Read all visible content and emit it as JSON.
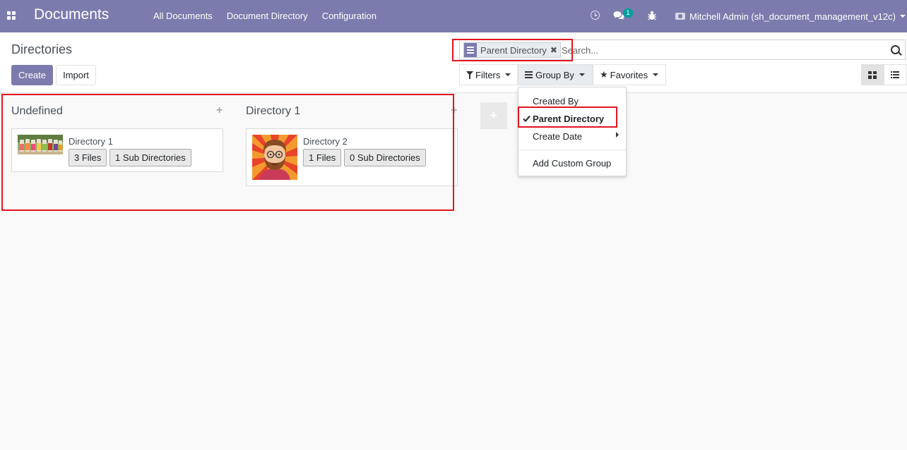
{
  "navbar": {
    "brand": "Documents",
    "menu": [
      "All Documents",
      "Document Directory",
      "Configuration"
    ],
    "chat_count": "1",
    "user_name": "Mitchell Admin (sh_document_management_v12c)",
    "icons": [
      "apps-grid-icon",
      "clock-icon",
      "chat-icon",
      "bug-icon",
      "camera-icon"
    ],
    "color": "#7c7bad"
  },
  "control_panel": {
    "title": "Directories",
    "create_label": "Create",
    "import_label": "Import",
    "search": {
      "facet_value": "Parent Directory",
      "facet_remove": "✖",
      "placeholder": "Search..."
    },
    "filters_label": "Filters",
    "group_by_label": "Group By",
    "favorites_label": "Favorites",
    "views": [
      "kanban",
      "list"
    ],
    "active_view": "kanban"
  },
  "group_by_dropdown": {
    "items": [
      {
        "label": "Created By",
        "checked": false
      },
      {
        "label": "Parent Directory",
        "checked": true
      },
      {
        "label": "Create Date",
        "checked": false,
        "submenu": true
      },
      {
        "label": "Add Custom Group",
        "checked": false
      }
    ]
  },
  "kanban": {
    "columns": [
      {
        "title": "Undefined",
        "add": "+",
        "cards": [
          {
            "name": "Directory 1",
            "files_label": "3 Files",
            "sub_label": "1 Sub Directories",
            "image": "bottles-photo"
          }
        ]
      },
      {
        "title": "Directory 1",
        "add": "+",
        "cards": [
          {
            "name": "Directory 2",
            "files_label": "1 Files",
            "sub_label": "0 Sub Directories",
            "image": "bearded-avatar"
          }
        ]
      }
    ],
    "add_column": "+"
  }
}
